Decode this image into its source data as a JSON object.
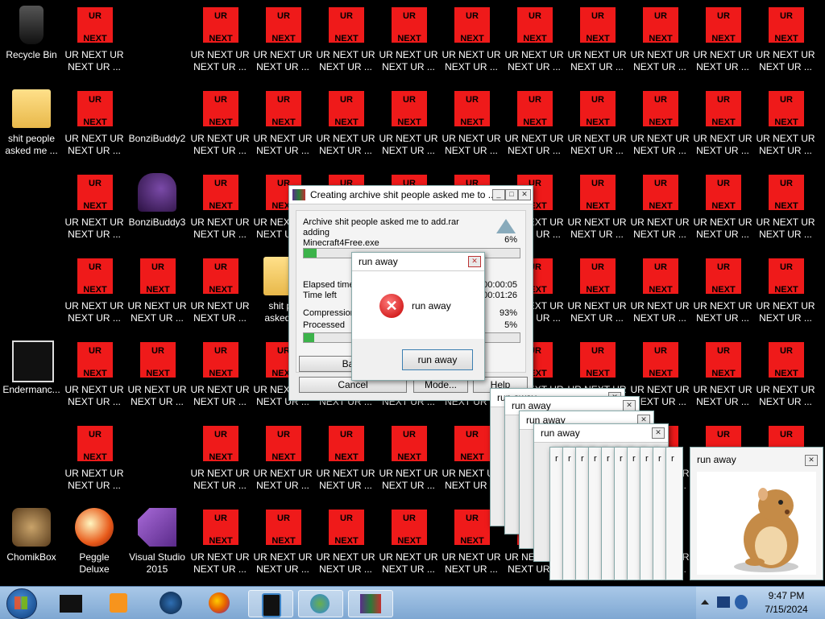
{
  "desktop": {
    "ur_tile": {
      "top": "UR",
      "bottom": "NEXT",
      "label_line1": "UR NEXT UR",
      "label_line2": "NEXT UR ..."
    },
    "icons": {
      "recycle_bin": "Recycle Bin",
      "shit_people_line1": "shit people",
      "shit_people_line2": "asked me ...",
      "bonzi2": "BonziBuddy2",
      "bonzi3": "BonziBuddy3",
      "enderman": "Endermanc...",
      "chomik": "ChomikBox",
      "peggle": "Peggle Deluxe",
      "vs_line1": "Visual Studio",
      "vs_line2": "2015",
      "hidden_folder_line1": "shit pe",
      "hidden_folder_line2": "asked m"
    }
  },
  "archive_dialog": {
    "title": "Creating archive shit people asked me to ...",
    "archive_line": "Archive shit people asked me to add.rar",
    "action": "adding",
    "file": "Minecraft4Free.exe",
    "file_percent": "6%",
    "elapsed_label": "Elapsed time",
    "elapsed_value": "00:00:05",
    "left_label": "Time left",
    "left_value": "00:01:26",
    "compression_label": "Compression",
    "compression_value": "93%",
    "processed_label": "Processed",
    "processed_value": "5%",
    "file_progress": 0.06,
    "processed_progress": 0.05,
    "btn_background": "Back",
    "btn_cancel": "Cancel",
    "btn_mode": "Mode...",
    "btn_help": "Help"
  },
  "run_away_dialog": {
    "title": "run away",
    "message": "run away",
    "button": "run away"
  },
  "stacked_windows": {
    "title": "run away",
    "strip_label": "r"
  },
  "hamster_window": {
    "title": "run away"
  },
  "taskbar": {
    "time": "9:47 PM",
    "date": "7/15/2024"
  }
}
